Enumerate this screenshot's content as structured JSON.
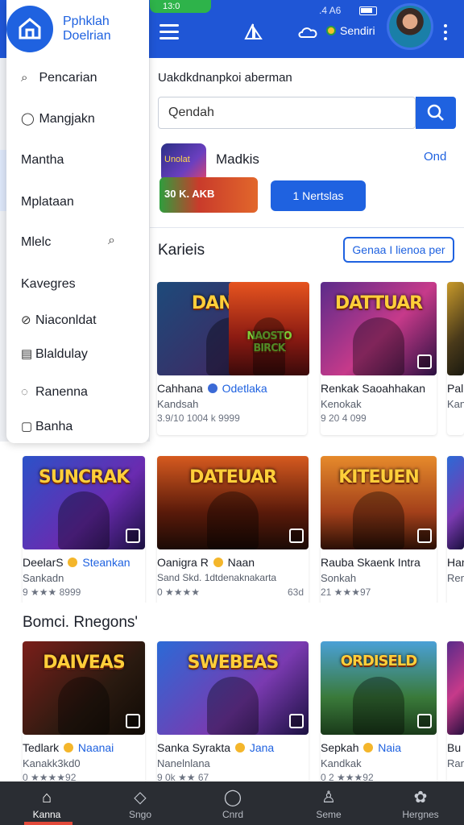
{
  "status_bar": {
    "left_text": "13:0",
    "right_text": ".4 A6"
  },
  "header": {
    "coin_label": "Sendiri"
  },
  "drawer": {
    "brand": [
      "Pphklah",
      "Doelrian"
    ],
    "items": [
      {
        "icon": "search-icon",
        "label": "Pencarian"
      },
      {
        "icon": "chat-icon",
        "label": "Mangjakn"
      },
      {
        "icon": "",
        "label": "Mantha"
      },
      {
        "icon": "",
        "label": "Mplataan"
      },
      {
        "icon": "",
        "label": "Mlelc"
      },
      {
        "icon": "",
        "label": "Kavegres"
      },
      {
        "icon": "tag-icon",
        "label": "Niaconldat"
      },
      {
        "icon": "calendar-icon",
        "label": "Blaldulay"
      },
      {
        "icon": "chat-icon",
        "label": "Ranenna"
      },
      {
        "icon": "book-icon",
        "label": "Banha"
      }
    ]
  },
  "main": {
    "headline": "Uakdkdnanpkoi aberman",
    "search": {
      "value": "Qendah"
    },
    "promo": {
      "icon_text": "Unolat",
      "title": "Madkis",
      "link": "Ond",
      "banner_text": "30  K. AKB",
      "button": "1 Nertslas"
    },
    "section1": {
      "title": "Karieis",
      "button": "Genaa I lienoa per"
    },
    "row1": [
      {
        "art": "DANAAN",
        "title": "Cahhana",
        "tag": "Odetlaka",
        "sub": "Kandsah",
        "rating": "3.9/10 1004 k 9999",
        "more": ""
      },
      {
        "art": "NAOSTO BIRCK",
        "title": "",
        "tag": "",
        "sub": "",
        "rating": "",
        "more": ""
      },
      {
        "art": "DATTUAR",
        "title": "Renkak Saoahhakan",
        "tag": "",
        "sub": "Kenokak",
        "rating": "9 20 4 099",
        "more": ""
      },
      {
        "art": "",
        "title": "Pal",
        "tag": "",
        "sub": "Kan",
        "rating": "",
        "more": ""
      }
    ],
    "row2": [
      {
        "art": "SUNCRAK",
        "title": "DeelarS",
        "tag": "Steankan",
        "sub": "Sankadn",
        "rating": "9 ★★★ 8999",
        "more": ""
      },
      {
        "art": "DATEUAR",
        "title": "Oanigra R",
        "tag": "Naan",
        "sub": "Sand Skd. 1dtdenaknakarta",
        "rating": "0 ★★★★",
        "more": "63d"
      },
      {
        "art": "KITEUEN",
        "title": "Rauba Skaenk Intra",
        "tag": "",
        "sub": "Sonkah",
        "rating": "21 ★★★97",
        "more": ""
      },
      {
        "art": "",
        "title": "Han",
        "tag": "",
        "sub": "Ren",
        "rating": "",
        "more": ""
      }
    ],
    "section2": {
      "title": "Bomci. Rnegons'"
    },
    "row3": [
      {
        "art": "DAIVEAS",
        "title": "Tedlark",
        "tag": "Naanai",
        "sub": "Kanakk3kd0",
        "rating": "0 ★★★★92",
        "more": ""
      },
      {
        "art": "SWEBEAS",
        "title": "Sanka Syrakta",
        "tag": "Jana",
        "sub": "Nanelnlana",
        "rating": "9 0k ★★ 67",
        "more": ""
      },
      {
        "art": "ORDISELD",
        "title": "Sepkah",
        "tag": "Naia",
        "sub": "Kandkak",
        "rating": "0 2 ★★★92",
        "more": ""
      },
      {
        "art": "",
        "title": "Bu",
        "tag": "",
        "sub": "Ran",
        "rating": "",
        "more": ""
      }
    ]
  },
  "bottom_nav": [
    {
      "icon": "home-icon",
      "label": "Kanna",
      "active": true
    },
    {
      "icon": "shop-icon",
      "label": "Sngo"
    },
    {
      "icon": "chat-icon",
      "label": "Cnrd"
    },
    {
      "icon": "user-icon",
      "label": "Seme"
    },
    {
      "icon": "settings-icon",
      "label": "Hergnes"
    }
  ]
}
